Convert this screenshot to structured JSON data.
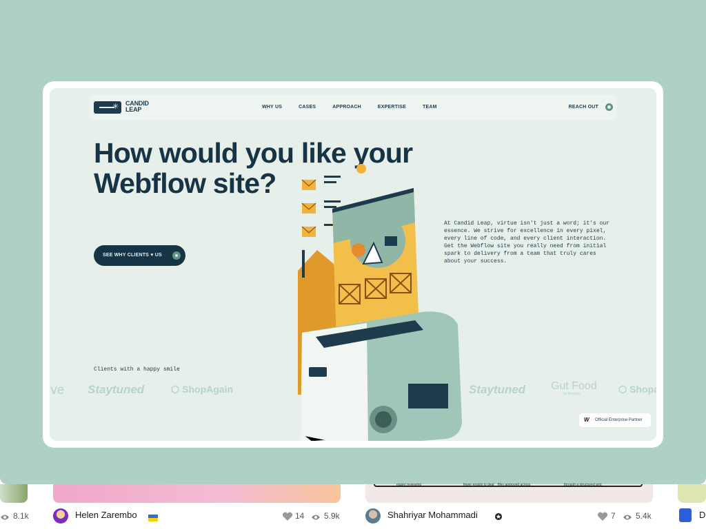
{
  "nav": {
    "logo_text": "CANDID LEAP",
    "links": [
      "WHY US",
      "CASES",
      "APPROACH",
      "EXPERTISE",
      "TEAM"
    ],
    "reach_out": "REACH OUT"
  },
  "hero": {
    "title": "How would you like your Webflow site?",
    "cta": "SEE WHY CLIENTS ♥ US",
    "description": "At Candid Leap, virtue isn't just a word; it's our essence. We strive for excellence in every pixel, every line of code, and every client interaction. Get the Webflow site you really need from initial spark to delivery from a team that truly cares about your success."
  },
  "clients": {
    "label": "Clients with a happy smile",
    "logos": [
      "ive",
      "Staytuned",
      "ShopAgain",
      "Staytuned",
      "Gut Food",
      "Shopa"
    ],
    "gut_food_sub": "by Berners"
  },
  "partner_badge": "Official Enterprise Partner",
  "feed": {
    "left_views": "8.1k",
    "shot1": {
      "author": "Helen Zarembo",
      "likes": "14",
      "views": "5.9k"
    },
    "shot2": {
      "author": "Shahriyar Mohammadi",
      "likes": "7",
      "views": "5.4k"
    },
    "shot2_caption_bits": [
      "easier reviewing",
      "fewer emails to deal",
      "files approved across",
      "through a structured and"
    ],
    "right_author_partial": "D"
  },
  "colors": {
    "stage_bg": "#afd1c5",
    "site_bg": "#e6efe9",
    "navy": "#173447",
    "accent_green": "#5d9486"
  },
  "icons": [
    "heart-icon",
    "eye-icon",
    "verified-icon",
    "ukraine-flag-icon",
    "webflow-icon"
  ]
}
